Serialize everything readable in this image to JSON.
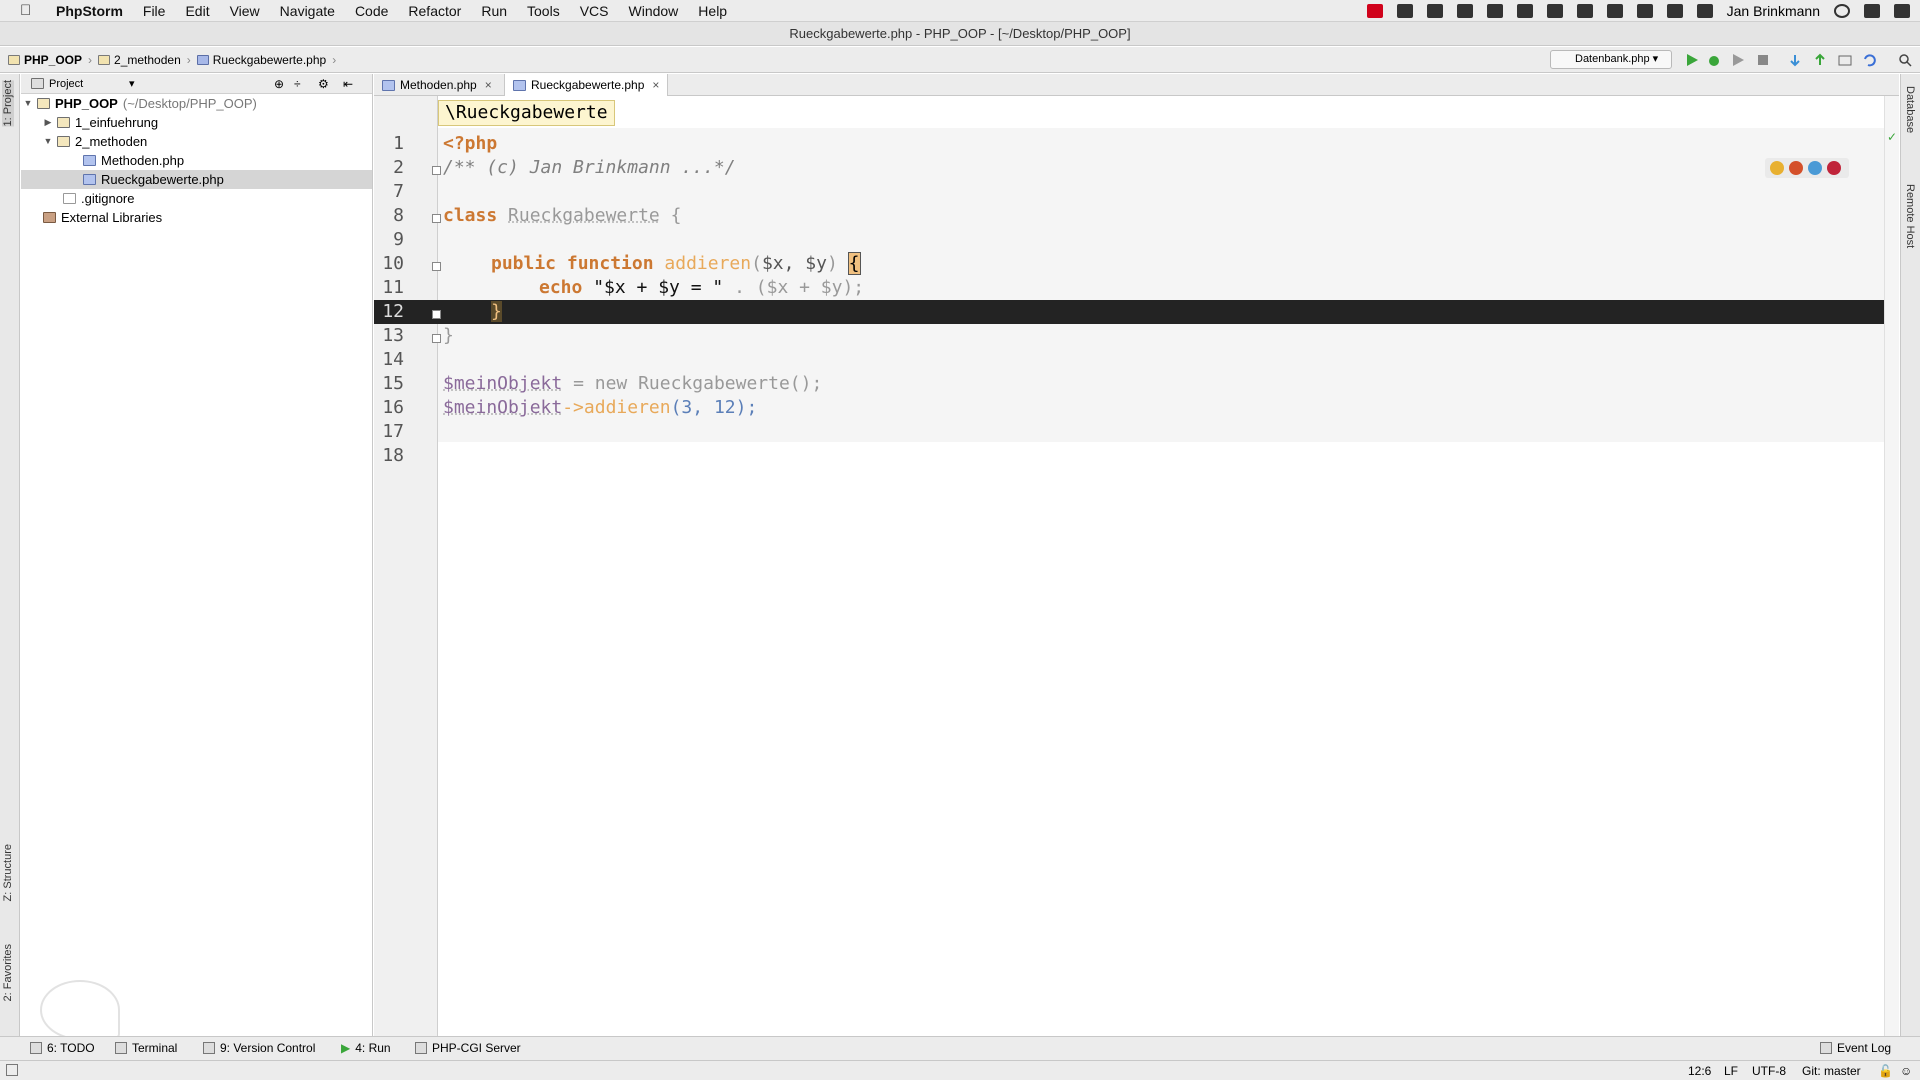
{
  "menubar": {
    "app": "PhpStorm",
    "items": [
      "File",
      "Edit",
      "View",
      "Navigate",
      "Code",
      "Refactor",
      "Run",
      "Tools",
      "VCS",
      "Window",
      "Help"
    ],
    "user": "Jan Brinkmann"
  },
  "titlebar": {
    "title": "Rueckgabewerte.php - PHP_OOP - [~/Desktop/PHP_OOP]"
  },
  "breadcrumbs": [
    "PHP_OOP",
    "2_methoden",
    "Rueckgabewerte.php"
  ],
  "run_config": "Datenbank.php",
  "project_panel": {
    "header": "Project",
    "tree": [
      {
        "label": "PHP_OOP",
        "suffix": "(~/Desktop/PHP_OOP)",
        "type": "folder",
        "expanded": true
      },
      {
        "label": "1_einfuehrung",
        "type": "folder",
        "expanded": false
      },
      {
        "label": "2_methoden",
        "type": "folder",
        "expanded": true
      },
      {
        "label": "Methoden.php",
        "type": "php"
      },
      {
        "label": "Rueckgabewerte.php",
        "type": "php",
        "selected": true
      },
      {
        "label": ".gitignore",
        "type": "txt"
      },
      {
        "label": "External Libraries",
        "type": "lib"
      }
    ]
  },
  "left_stripe": {
    "project": "1: Project",
    "structure": "Z: Structure",
    "favorites": "2: Favorites"
  },
  "right_stripe": {
    "database": "Database",
    "remote": "Remote Host"
  },
  "tabs": [
    {
      "label": "Methoden.php",
      "active": false
    },
    {
      "label": "Rueckgabewerte.php",
      "active": true
    }
  ],
  "scope": "\\Rueckgabewerte",
  "line_numbers": [
    "1",
    "2",
    "7",
    "8",
    "9",
    "10",
    "11",
    "12",
    "13",
    "14",
    "15",
    "16",
    "17",
    "18"
  ],
  "code": {
    "l1": "<?php",
    "l2": "/** (c) Jan Brinkmann ...*/",
    "l8_kw": "class",
    "l8_name": "Rueckgabewerte",
    "l8_brace": "{",
    "l10_kw": "public function",
    "l10_fn": "addieren",
    "l10_args": "$x, $y",
    "l10_brace": "{",
    "l11_kw": "echo",
    "l11_str": "\"$x + $y = \"",
    "l11_rest": ". ($x + $y);",
    "l12": "}",
    "l13": "}",
    "l15_var": "$meinObjekt",
    "l15_rest": "= new Rueckgabewerte();",
    "l16_var": "$meinObjekt",
    "l16_fn": "->addieren",
    "l16_args": "(3, 12);"
  },
  "bottom_tools": [
    "6: TODO",
    "Terminal",
    "9: Version Control",
    "4: Run",
    "PHP-CGI Server"
  ],
  "event_log": "Event Log",
  "status": {
    "position": "12:6",
    "line_sep": "LF",
    "encoding": "UTF-8",
    "git": "Git: master"
  }
}
